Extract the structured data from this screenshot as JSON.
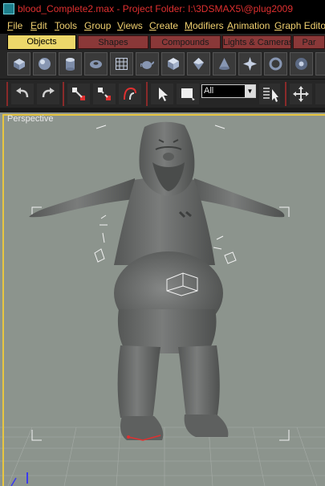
{
  "window": {
    "title": "blood_Complete2.max    - Project Folder: I:\\3DSMAX5\\@plug2009"
  },
  "menu": {
    "items": [
      "File",
      "Edit",
      "Tools",
      "Group",
      "Views",
      "Create",
      "Modifiers",
      "Animation",
      "Graph Editors"
    ]
  },
  "tabs": {
    "items": [
      "Objects",
      "Shapes",
      "Compounds",
      "Lights & Cameras",
      "Par"
    ],
    "active": "Objects"
  },
  "create_panel": {
    "icons": [
      "box-icon",
      "sphere-icon",
      "cylinder-icon",
      "torus-icon",
      "plane-grid-icon",
      "teapot-icon",
      "cube-icon",
      "geosphere-icon",
      "cone-icon",
      "burst-icon",
      "gear-icon",
      "hedra-icon"
    ]
  },
  "toolbar": {
    "selection_filter": "All",
    "icons": [
      "undo-icon",
      "redo-icon",
      "select-and-link-icon",
      "unlink-icon",
      "bind-space-warp-icon",
      "select-cursor-icon",
      "select-region-icon",
      "select-by-name-icon",
      "select-and-move-icon"
    ]
  },
  "viewport": {
    "label": "Perspective",
    "background_color": "#8c948d",
    "active_border_color": "#e8c640",
    "model_color": "#6e706f"
  },
  "colors": {
    "title_text": "#e03030",
    "menu_text": "#f0d070",
    "tab_active": "#ecd76a",
    "tab_inactive": "#8a3838",
    "panel_bg": "#262626"
  }
}
